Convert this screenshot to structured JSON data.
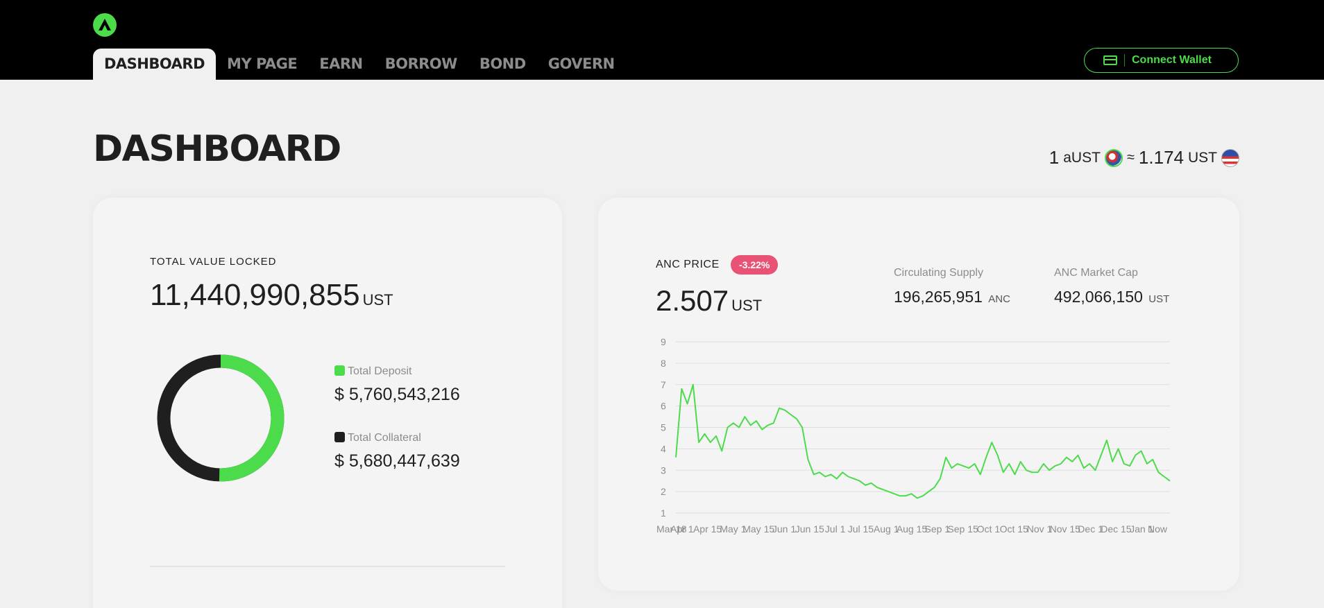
{
  "colors": {
    "accent": "#4bdb4b",
    "negative": "#e85275",
    "dark": "#1f1f1f",
    "muted": "#8c8c8c"
  },
  "header": {
    "logo_icon": "anchor-logo-icon",
    "nav": [
      {
        "label": "DASHBOARD",
        "active": true
      },
      {
        "label": "MY PAGE"
      },
      {
        "label": "EARN"
      },
      {
        "label": "BORROW"
      },
      {
        "label": "BOND"
      },
      {
        "label": "GOVERN"
      }
    ],
    "wallet_button": {
      "label": "Connect Wallet",
      "icon": "wallet-icon"
    }
  },
  "page": {
    "title": "DASHBOARD",
    "rate": {
      "left_amount": "1",
      "left_unit": "aUST",
      "approx": "≈",
      "right_amount": "1.174",
      "right_unit": "UST"
    }
  },
  "tvl": {
    "label": "TOTAL VALUE LOCKED",
    "value": "11,440,990,855",
    "unit": "UST",
    "deposit": {
      "label": "Total Deposit",
      "value": "$ 5,760,543,216",
      "amount": 5760543216
    },
    "collateral": {
      "label": "Total Collateral",
      "value": "$ 5,680,447,639",
      "amount": 5680447639
    }
  },
  "anc": {
    "label": "ANC PRICE",
    "change": "-3.22%",
    "price": "2.507",
    "price_unit": "UST",
    "supply": {
      "label": "Circulating Supply",
      "value": "196,265,951",
      "unit": "ANC"
    },
    "market_cap": {
      "label": "ANC Market Cap",
      "value": "492,066,150",
      "unit": "UST"
    }
  },
  "chart_data": {
    "type": "line",
    "title": "",
    "xlabel": "",
    "ylabel": "",
    "ylim": [
      1,
      9
    ],
    "yticks": [
      1,
      2,
      3,
      4,
      5,
      6,
      7,
      8,
      9
    ],
    "xticks": [
      "Mar 18",
      "Apr 1",
      "Apr 15",
      "May 1",
      "May 15",
      "Jun 1",
      "Jun 15",
      "Jul 1",
      "Jul 15",
      "Aug 1",
      "Aug 15",
      "Sep 1",
      "Sep 15",
      "Oct 1",
      "Oct 15",
      "Nov 1",
      "Nov 15",
      "Dec 1",
      "Dec 15",
      "Jan 1",
      "Now"
    ],
    "grid": true,
    "series": [
      {
        "color": "#4bdb4b",
        "values": [
          3.6,
          6.8,
          6.1,
          7.0,
          4.3,
          4.7,
          4.3,
          4.6,
          3.9,
          5.0,
          5.2,
          5.0,
          5.5,
          5.1,
          5.3,
          4.9,
          5.1,
          5.2,
          5.9,
          5.8,
          5.6,
          5.4,
          5.0,
          3.5,
          2.8,
          2.9,
          2.7,
          2.8,
          2.6,
          2.9,
          2.7,
          2.6,
          2.5,
          2.3,
          2.4,
          2.2,
          2.1,
          2.0,
          1.9,
          1.8,
          1.8,
          1.9,
          1.7,
          1.8,
          2.0,
          2.2,
          2.6,
          3.6,
          3.1,
          3.3,
          3.2,
          3.1,
          3.3,
          2.8,
          3.6,
          4.3,
          3.7,
          2.9,
          3.3,
          2.8,
          3.4,
          3.0,
          2.9,
          2.9,
          3.3,
          3.0,
          3.2,
          3.3,
          3.6,
          3.4,
          3.7,
          3.1,
          3.3,
          3.0,
          3.7,
          4.4,
          3.4,
          4.0,
          3.3,
          3.2,
          3.7,
          3.9,
          3.3,
          3.5,
          2.9,
          2.7,
          2.5
        ]
      }
    ]
  }
}
